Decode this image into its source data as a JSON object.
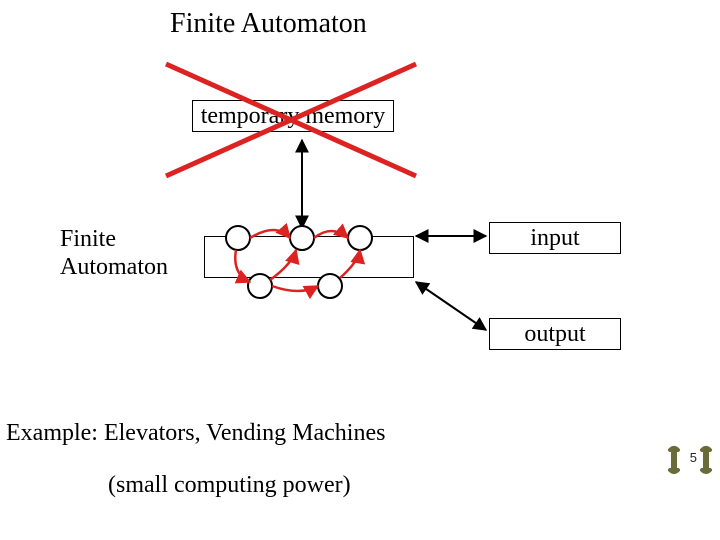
{
  "title": "Finite Automaton",
  "boxes": {
    "temp_memory": "temporary memory",
    "input": "input",
    "output": "output"
  },
  "labels": {
    "fa": "Finite\nAutomaton"
  },
  "captions": {
    "example": "Example: Elevators, Vending Machines",
    "small": "(small computing power)"
  },
  "slide_number": "5",
  "colors": {
    "red": "#d22",
    "olive": "#6b6b3a"
  }
}
